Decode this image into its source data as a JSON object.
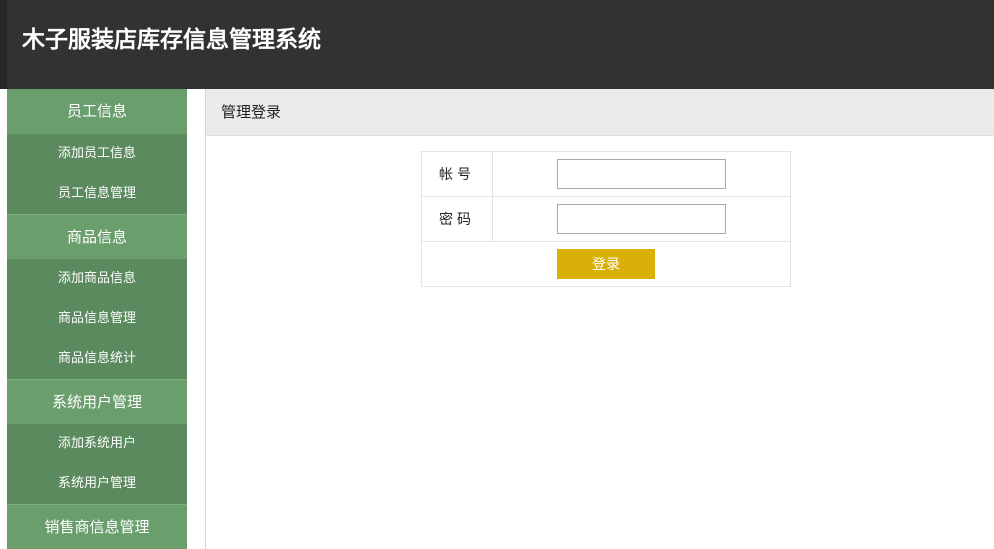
{
  "header": {
    "title": "木子服装店库存信息管理系统"
  },
  "sidebar": {
    "groups": [
      {
        "label": "员工信息",
        "items": [
          "添加员工信息",
          "员工信息管理"
        ]
      },
      {
        "label": "商品信息",
        "items": [
          "添加商品信息",
          "商品信息管理",
          "商品信息统计"
        ]
      },
      {
        "label": "系统用户管理",
        "items": [
          "添加系统用户",
          "系统用户管理"
        ]
      },
      {
        "label": "销售商信息管理",
        "items": []
      }
    ]
  },
  "main": {
    "breadcrumb": "管理登录",
    "form": {
      "account_label": "帐号",
      "account_value": "",
      "password_label": "密码",
      "password_value": "",
      "submit_label": "登录"
    }
  },
  "colors": {
    "header_bg": "#323232",
    "sidebar_group_bg": "#6a9e6d",
    "sidebar_item_bg": "#5a8a5e",
    "button_bg": "#d9b00a"
  }
}
